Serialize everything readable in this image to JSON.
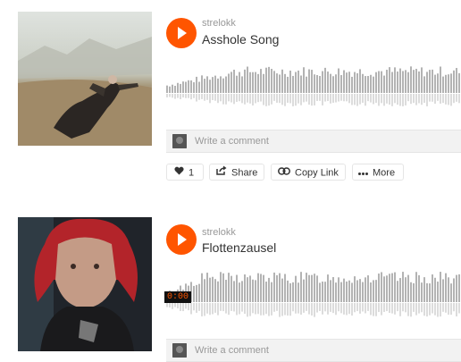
{
  "tracks": [
    {
      "username": "strelokk",
      "title": "Asshole Song",
      "comment_placeholder": "Write a comment",
      "actions": {
        "like_count": "1",
        "share_label": "Share",
        "copy_link_label": "Copy Link",
        "more_label": "More"
      }
    },
    {
      "username": "strelokk",
      "title": "Flottenzausel",
      "comment_placeholder": "Write a comment",
      "time": "0:00"
    }
  ],
  "colors": {
    "accent": "#ff5500",
    "waveform": "#b3b3b3",
    "waveform_reflection": "#dcdcdc"
  },
  "icons": [
    "play-icon",
    "heart-icon",
    "share-icon",
    "link-icon",
    "more-icon"
  ]
}
